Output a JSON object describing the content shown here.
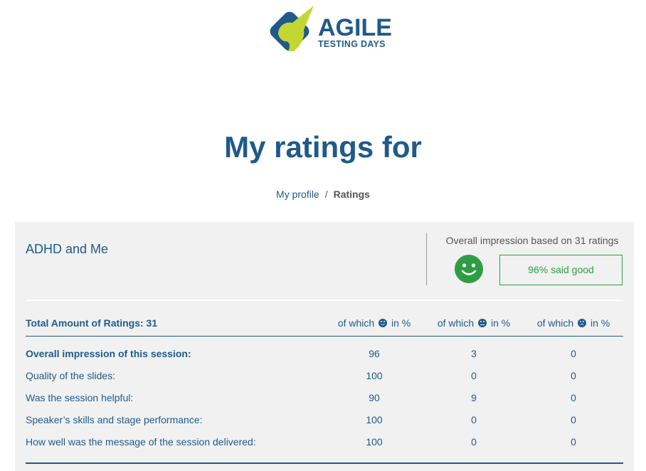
{
  "logo": {
    "line1": "AGILE",
    "line2": "TESTING DAYS"
  },
  "page_title": "My ratings for",
  "breadcrumb": {
    "parent": "My profile",
    "separator": "/",
    "current": "Ratings"
  },
  "session": {
    "title": "ADHD and Me",
    "overall_label": "Overall impression based on 31 ratings",
    "overall_result": "96% said good"
  },
  "colors": {
    "primary": "#1f5a8a",
    "good": "#2f9e43",
    "card_bg": "#f1f1f1"
  },
  "table": {
    "header": {
      "total": "Total Amount of Ratings: 31",
      "col_prefix": "of which",
      "col_suffix": "in %",
      "columns": [
        "good-face-icon",
        "neutral-face-icon",
        "bad-face-icon"
      ]
    },
    "rows": [
      {
        "question": "Overall impression of this session:",
        "good": "96",
        "neutral": "3",
        "bad": "0"
      },
      {
        "question": "Quality of the slides:",
        "good": "100",
        "neutral": "0",
        "bad": "0"
      },
      {
        "question": "Was the session helpful:",
        "good": "90",
        "neutral": "9",
        "bad": "0"
      },
      {
        "question": "Speaker’s skills and stage performance:",
        "good": "100",
        "neutral": "0",
        "bad": "0"
      },
      {
        "question": "How well was the message of the session delivered:",
        "good": "100",
        "neutral": "0",
        "bad": "0"
      }
    ]
  }
}
